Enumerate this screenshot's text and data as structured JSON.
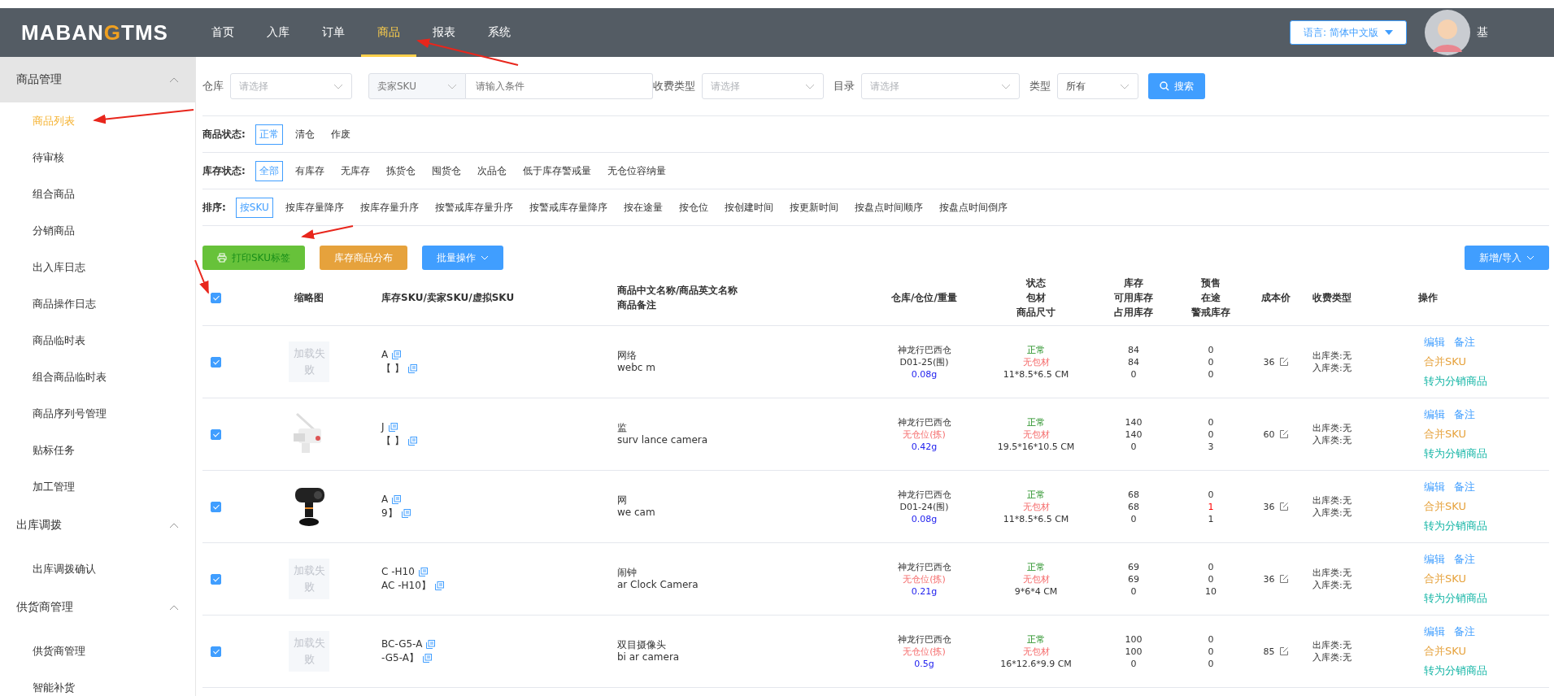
{
  "header": {
    "logo": [
      "MABAN",
      "G",
      "TMS"
    ],
    "nav": [
      {
        "label": "首页",
        "selected": false
      },
      {
        "label": "入库",
        "selected": false
      },
      {
        "label": "订单",
        "selected": false
      },
      {
        "label": "商品",
        "selected": true
      },
      {
        "label": "报表",
        "selected": false
      },
      {
        "label": "系统",
        "selected": false
      }
    ],
    "language": "语言: 简体中文版",
    "user": "基"
  },
  "sidebar": [
    {
      "label": "商品管理",
      "expanded": true,
      "highlighted": true,
      "children": [
        {
          "label": "商品列表",
          "selected": true
        },
        {
          "label": "待审核",
          "selected": false
        },
        {
          "label": "组合商品",
          "selected": false
        },
        {
          "label": "分销商品",
          "selected": false
        },
        {
          "label": "出入库日志",
          "selected": false
        },
        {
          "label": "商品操作日志",
          "selected": false
        },
        {
          "label": "商品临时表",
          "selected": false
        },
        {
          "label": "组合商品临时表",
          "selected": false
        },
        {
          "label": "商品序列号管理",
          "selected": false
        },
        {
          "label": "贴标任务",
          "selected": false
        },
        {
          "label": "加工管理",
          "selected": false
        }
      ]
    },
    {
      "label": "出库调拨",
      "expanded": true,
      "highlighted": false,
      "children": [
        {
          "label": "出库调拨确认",
          "selected": false
        }
      ]
    },
    {
      "label": "供货商管理",
      "expanded": true,
      "highlighted": false,
      "children": [
        {
          "label": "供货商管理",
          "selected": false
        },
        {
          "label": "智能补货",
          "selected": false
        }
      ]
    }
  ],
  "filters": {
    "warehouse": {
      "label": "仓库",
      "placeholder": "请选择"
    },
    "sku_type": {
      "value": "卖家SKU"
    },
    "condition": {
      "placeholder": "请输入条件"
    },
    "fee_type": {
      "label": "收费类型",
      "placeholder": "请选择"
    },
    "catalog": {
      "label": "目录",
      "placeholder": "请选择"
    },
    "type": {
      "label": "类型",
      "value": "所有"
    },
    "search": "搜索"
  },
  "status_rows": [
    {
      "label": "商品状态:",
      "options": [
        {
          "label": "正常",
          "selected": true
        },
        {
          "label": "清仓",
          "selected": false
        },
        {
          "label": "作废",
          "selected": false
        }
      ]
    },
    {
      "label": "库存状态:",
      "options": [
        {
          "label": "全部",
          "selected": true
        },
        {
          "label": "有库存",
          "selected": false
        },
        {
          "label": "无库存",
          "selected": false
        },
        {
          "label": "拣货仓",
          "selected": false
        },
        {
          "label": "囤货仓",
          "selected": false
        },
        {
          "label": "次品仓",
          "selected": false
        },
        {
          "label": "低于库存警戒量",
          "selected": false
        },
        {
          "label": "无仓位容纳量",
          "selected": false
        }
      ]
    },
    {
      "label": "排序:",
      "options": [
        {
          "label": "按SKU",
          "selected": true
        },
        {
          "label": "按库存量降序",
          "selected": false
        },
        {
          "label": "按库存量升序",
          "selected": false
        },
        {
          "label": "按警戒库存量升序",
          "selected": false
        },
        {
          "label": "按警戒库存量降序",
          "selected": false
        },
        {
          "label": "按在途量",
          "selected": false
        },
        {
          "label": "按仓位",
          "selected": false
        },
        {
          "label": "按创建时间",
          "selected": false
        },
        {
          "label": "按更新时间",
          "selected": false
        },
        {
          "label": "按盘点时间顺序",
          "selected": false
        },
        {
          "label": "按盘点时间倒序",
          "selected": false
        }
      ]
    }
  ],
  "actions": [
    {
      "label": "打印SKU标签",
      "kind": "print"
    },
    {
      "label": "库存商品分布",
      "kind": "plain"
    },
    {
      "label": "批量操作",
      "kind": "dropdown"
    }
  ],
  "add_import": "新增/导入",
  "table": {
    "all_checked": true,
    "columns": [
      [
        "缩略图"
      ],
      [
        "库存SKU/卖家SKU/虚拟SKU"
      ],
      [
        "商品中文名称/商品英文名称",
        "商品备注"
      ],
      [
        "仓库/仓位/重量"
      ],
      [
        "状态",
        "包材",
        "商品尺寸"
      ],
      [
        "库存",
        "可用库存",
        "占用库存"
      ],
      [
        "预售",
        "在途",
        "警戒库存"
      ],
      [
        "成本价"
      ],
      [
        "收费类型"
      ],
      [
        "操作"
      ]
    ],
    "rows": [
      {
        "checked": true,
        "thumb": {
          "kind": "failed",
          "text": "加载失败"
        },
        "sku": [
          "A",
          "【  】"
        ],
        "name": [
          "网络",
          "webc m"
        ],
        "warehouse": {
          "name": "神龙行巴西仓",
          "location": "D01-25(围)",
          "location_missing": false,
          "weight": "0.08g"
        },
        "status": "正常",
        "packing": "无包材",
        "size": "11*8.5*6.5 CM",
        "stock": [
          "84",
          "84",
          "0"
        ],
        "presale": [
          {
            "text": "0",
            "alert": false
          },
          {
            "text": "0",
            "alert": false
          },
          {
            "text": "0",
            "alert": false
          }
        ],
        "cost": "36",
        "fees": [
          "出库类:无",
          "入库类:无"
        ],
        "ops": [
          "编辑",
          "备注",
          "合并SKU",
          "转为分销商品"
        ]
      },
      {
        "checked": true,
        "thumb": {
          "kind": "picture"
        },
        "sku": [
          "J",
          "【  】"
        ],
        "name": [
          "监",
          "surv lance camera"
        ],
        "warehouse": {
          "name": "神龙行巴西仓",
          "location": "无仓位(拣)",
          "location_missing": true,
          "weight": "0.42g"
        },
        "status": "正常",
        "packing": "无包材",
        "size": "19.5*16*10.5 CM",
        "stock": [
          "140",
          "140",
          "0"
        ],
        "presale": [
          {
            "text": "0",
            "alert": false
          },
          {
            "text": "0",
            "alert": false
          },
          {
            "text": "3",
            "alert": false
          }
        ],
        "cost": "60",
        "fees": [
          "出库类:无",
          "入库类:无"
        ],
        "ops": [
          "编辑",
          "备注",
          "合并SKU",
          "转为分销商品"
        ]
      },
      {
        "checked": true,
        "thumb": {
          "kind": "picture"
        },
        "sku": [
          "A",
          "9】"
        ],
        "name": [
          "网",
          "we cam"
        ],
        "warehouse": {
          "name": "神龙行巴西仓",
          "location": "D01-24(围)",
          "location_missing": false,
          "weight": "0.08g"
        },
        "status": "正常",
        "packing": "无包材",
        "size": "11*8.5*6.5 CM",
        "stock": [
          "68",
          "68",
          "0"
        ],
        "presale": [
          {
            "text": "0",
            "alert": false
          },
          {
            "text": "1",
            "alert": true
          },
          {
            "text": "1",
            "alert": false
          }
        ],
        "cost": "36",
        "fees": [
          "出库类:无",
          "入库类:无"
        ],
        "ops": [
          "编辑",
          "备注",
          "合并SKU",
          "转为分销商品"
        ]
      },
      {
        "checked": true,
        "thumb": {
          "kind": "failed",
          "text": "加载失败"
        },
        "sku": [
          "C -H10",
          "AC -H10】"
        ],
        "name": [
          "闹钟",
          "ar  Clock Camera"
        ],
        "warehouse": {
          "name": "神龙行巴西仓",
          "location": "无仓位(拣)",
          "location_missing": true,
          "weight": "0.21g"
        },
        "status": "正常",
        "packing": "无包材",
        "size": "9*6*4 CM",
        "stock": [
          "69",
          "69",
          "0"
        ],
        "presale": [
          {
            "text": "0",
            "alert": false
          },
          {
            "text": "0",
            "alert": false
          },
          {
            "text": "10",
            "alert": false
          }
        ],
        "cost": "36",
        "fees": [
          "出库类:无",
          "入库类:无"
        ],
        "ops": [
          "编辑",
          "备注",
          "合并SKU",
          "转为分销商品"
        ]
      },
      {
        "checked": true,
        "thumb": {
          "kind": "failed",
          "text": "加载失败"
        },
        "sku": [
          "BC-G5-A",
          "-G5-A】"
        ],
        "name": [
          "双目摄像头",
          "bi   ar camera"
        ],
        "warehouse": {
          "name": "神龙行巴西仓",
          "location": "无仓位(拣)",
          "location_missing": true,
          "weight": "0.5g"
        },
        "status": "正常",
        "packing": "无包材",
        "size": "16*12.6*9.9 CM",
        "stock": [
          "100",
          "100",
          "0"
        ],
        "presale": [
          {
            "text": "0",
            "alert": false
          },
          {
            "text": "0",
            "alert": false
          },
          {
            "text": "0",
            "alert": false
          }
        ],
        "cost": "85",
        "fees": [
          "出库类:无",
          "入库类:无"
        ],
        "ops": [
          "编辑",
          "备注",
          "合并SKU",
          "转为分销商品"
        ]
      }
    ]
  }
}
